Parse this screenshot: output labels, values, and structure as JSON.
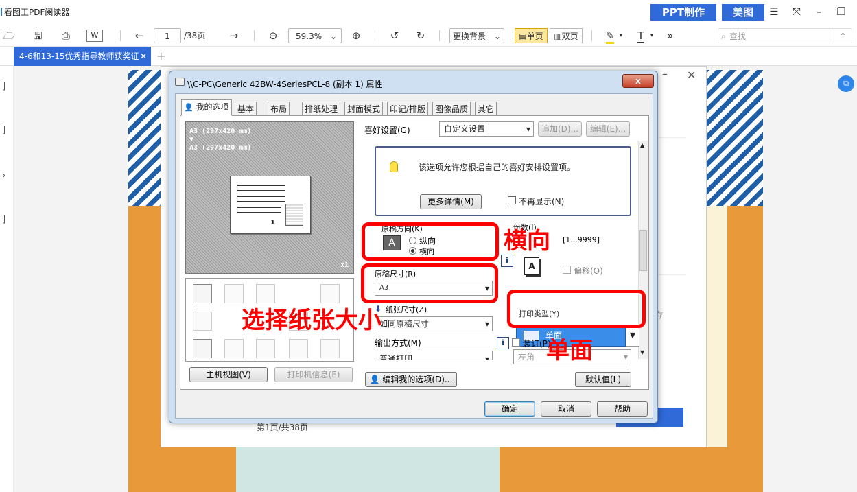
{
  "app": {
    "title": "看图王PDF阅读器",
    "ppt_label": "PPT制作",
    "meitu_label": "美图"
  },
  "toolbar": {
    "page_value": "1",
    "page_total": "/38页",
    "zoom_value": "59.3%",
    "background_label": "更换背景",
    "single_page_label": "单页",
    "double_page_label": "双页",
    "more_glyph": "»",
    "search_placeholder": "查找"
  },
  "tabs": {
    "doc_tab": "4-6和13-15优秀指导教师获奖证"
  },
  "document": {
    "page_info": "第1页/共38页",
    "side_text": "存"
  },
  "dialog": {
    "title": "\\\\C-PC\\Generic 42BW-4SeriesPCL-8 (副本 1) 属性",
    "close_glyph": "x",
    "tabs": [
      "我的选项",
      "基本",
      "布局",
      "排纸处理",
      "封面模式",
      "印记/排版",
      "图像品质",
      "其它"
    ],
    "preview": {
      "line1": "A3  (297x420 mm)",
      "arrow": "▼",
      "line2": "A3  (297x420 mm)",
      "page_num": "1",
      "scale": "x1"
    },
    "host_view_btn": "主机视图(V)",
    "printer_info_btn": "打印机信息(E)",
    "favorite_label": "喜好设置(G)",
    "favorite_value": "自定义设置",
    "add_btn": "追加(D)...",
    "edit_btn": "编辑(E)...",
    "info_text": "该选项允许您根据自己的喜好安排设置项。",
    "more_btn": "更多详情(M)",
    "no_show_label": "不再显示(N)",
    "orientation_label": "原稿方向(K)",
    "portrait_label": "纵向",
    "landscape_label": "横向",
    "copies_label": "份数(I)",
    "copies_range": "[1...9999]",
    "orig_size_label": "原稿尺寸(R)",
    "orig_size_value": "A3",
    "offset_label": "偏移(O)",
    "paper_size_label": "纸张尺寸(Z)",
    "paper_size_value": "如同原稿尺寸",
    "print_type_label": "打印类型(Y)",
    "print_type_value": "单面",
    "output_label": "输出方式(M)",
    "output_value": "普通打印",
    "binding_label": "装订(P)",
    "binding_value": "左角",
    "edit_my_options_btn": "编辑我的选项(D)...",
    "defaults_btn": "默认值(L)",
    "ok_btn": "确定",
    "cancel_btn": "取消",
    "help_btn": "帮助"
  },
  "annotations": {
    "landscape": "横向",
    "paper_size": "选择纸张大小",
    "single_side": "单面"
  },
  "colors": {
    "accent": "#2f6ad8",
    "annotation": "#ff0000",
    "selected": "#3a8de8"
  }
}
